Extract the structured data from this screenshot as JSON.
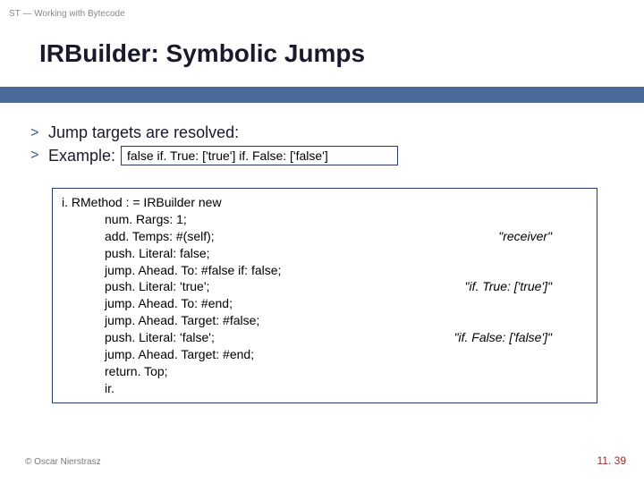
{
  "header": {
    "label": "ST — Working with Bytecode"
  },
  "title": "IRBuilder: Symbolic Jumps",
  "bullets": {
    "marker": ">",
    "b1": "Jump targets are resolved:",
    "b2": "Example:",
    "inline_code": "false if. True: ['true'] if. False: ['false']"
  },
  "code": {
    "l0": "i. RMethod : = IRBuilder new",
    "l1": "num. Rargs: 1;",
    "l2": "add. Temps: #(self);",
    "c2": "\"receiver\"",
    "l3": "push. Literal: false;",
    "l4": "jump. Ahead. To: #false if: false;",
    "l5": "push. Literal: 'true';",
    "c5": "\"if. True: ['true']\"",
    "l6": "jump. Ahead. To: #end;",
    "l7": "jump. Ahead. Target: #false;",
    "l8": "push. Literal: 'false';",
    "c8": "\"if. False: ['false']\"",
    "l9": "jump. Ahead. Target: #end;",
    "l10": "return. Top;",
    "l11": "ir."
  },
  "footer": {
    "left": "© Oscar Nierstrasz",
    "right": "11. 39"
  }
}
